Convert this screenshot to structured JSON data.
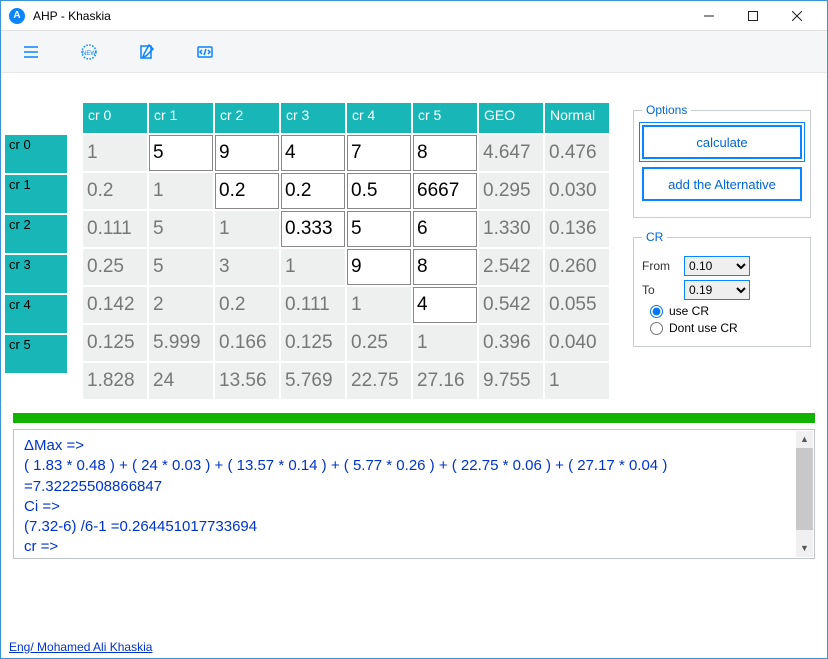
{
  "window": {
    "title": "AHP - Khaskia"
  },
  "toolbar_icons": [
    "menu-icon",
    "new-icon",
    "edit-icon",
    "code-icon"
  ],
  "col_headers": [
    "cr 0",
    "cr 1",
    "cr 2",
    "cr 3",
    "cr 4",
    "cr 5",
    "GEO",
    "Normal"
  ],
  "row_labels": [
    "cr 0",
    "cr 1",
    "cr 2",
    "cr 3",
    "cr 4",
    "cr 5"
  ],
  "grid": [
    [
      {
        "v": "1",
        "editable": false
      },
      {
        "v": "5",
        "editable": true
      },
      {
        "v": "9",
        "editable": true
      },
      {
        "v": "4",
        "editable": true
      },
      {
        "v": "7",
        "editable": true
      },
      {
        "v": "8",
        "editable": true
      },
      {
        "v": "4.647",
        "editable": false
      },
      {
        "v": "0.476",
        "editable": false
      }
    ],
    [
      {
        "v": "0.2",
        "editable": false
      },
      {
        "v": "1",
        "editable": false
      },
      {
        "v": "0.2",
        "editable": true
      },
      {
        "v": "0.2",
        "editable": true
      },
      {
        "v": "0.5",
        "editable": true
      },
      {
        "v": "6667",
        "editable": true
      },
      {
        "v": "0.295",
        "editable": false
      },
      {
        "v": "0.030",
        "editable": false
      }
    ],
    [
      {
        "v": "0.111",
        "editable": false
      },
      {
        "v": "5",
        "editable": false
      },
      {
        "v": "1",
        "editable": false
      },
      {
        "v": "0.333",
        "editable": true
      },
      {
        "v": "5",
        "editable": true
      },
      {
        "v": "6",
        "editable": true
      },
      {
        "v": "1.330",
        "editable": false
      },
      {
        "v": "0.136",
        "editable": false
      }
    ],
    [
      {
        "v": "0.25",
        "editable": false
      },
      {
        "v": "5",
        "editable": false
      },
      {
        "v": "3",
        "editable": false
      },
      {
        "v": "1",
        "editable": false
      },
      {
        "v": "9",
        "editable": true
      },
      {
        "v": "8",
        "editable": true
      },
      {
        "v": "2.542",
        "editable": false
      },
      {
        "v": "0.260",
        "editable": false
      }
    ],
    [
      {
        "v": "0.142",
        "editable": false
      },
      {
        "v": "2",
        "editable": false
      },
      {
        "v": "0.2",
        "editable": false
      },
      {
        "v": "0.111",
        "editable": false
      },
      {
        "v": "1",
        "editable": false
      },
      {
        "v": "4",
        "editable": true
      },
      {
        "v": "0.542",
        "editable": false
      },
      {
        "v": "0.055",
        "editable": false
      }
    ],
    [
      {
        "v": "0.125",
        "editable": false
      },
      {
        "v": "5.999",
        "editable": false
      },
      {
        "v": "0.166",
        "editable": false
      },
      {
        "v": "0.125",
        "editable": false
      },
      {
        "v": "0.25",
        "editable": false
      },
      {
        "v": "1",
        "editable": false
      },
      {
        "v": "0.396",
        "editable": false
      },
      {
        "v": "0.040",
        "editable": false
      }
    ],
    [
      {
        "v": "1.828",
        "editable": false
      },
      {
        "v": "24",
        "editable": false
      },
      {
        "v": "13.56",
        "editable": false
      },
      {
        "v": "5.769",
        "editable": false
      },
      {
        "v": "22.75",
        "editable": false
      },
      {
        "v": "27.16",
        "editable": false
      },
      {
        "v": "9.755",
        "editable": false
      },
      {
        "v": "1",
        "editable": false
      }
    ]
  ],
  "options": {
    "legend": "Options",
    "calculate": "calculate",
    "add_alt": "add the Alternative"
  },
  "cr": {
    "legend": "CR",
    "from_label": "From",
    "to_label": "To",
    "from_value": "0.10",
    "to_value": "0.19",
    "use_label": "use CR",
    "dont_label": "Dont use CR",
    "selected": "use"
  },
  "log_lines": [
    "ΔMax =>",
    "( 1.83 * 0.48 )  + ( 24 * 0.03 )  + ( 13.57 * 0.14 )  + ( 5.77 * 0.26 )  + ( 22.75 * 0.06 )  + ( 27.17 * 0.04 )  =7.32225508866847",
    "Ci =>",
    "(7.32-6) /6-1 =0.264451017733694",
    "cr =>"
  ],
  "footer": {
    "text": "Eng/ Mohamed Ali Khaskia"
  }
}
